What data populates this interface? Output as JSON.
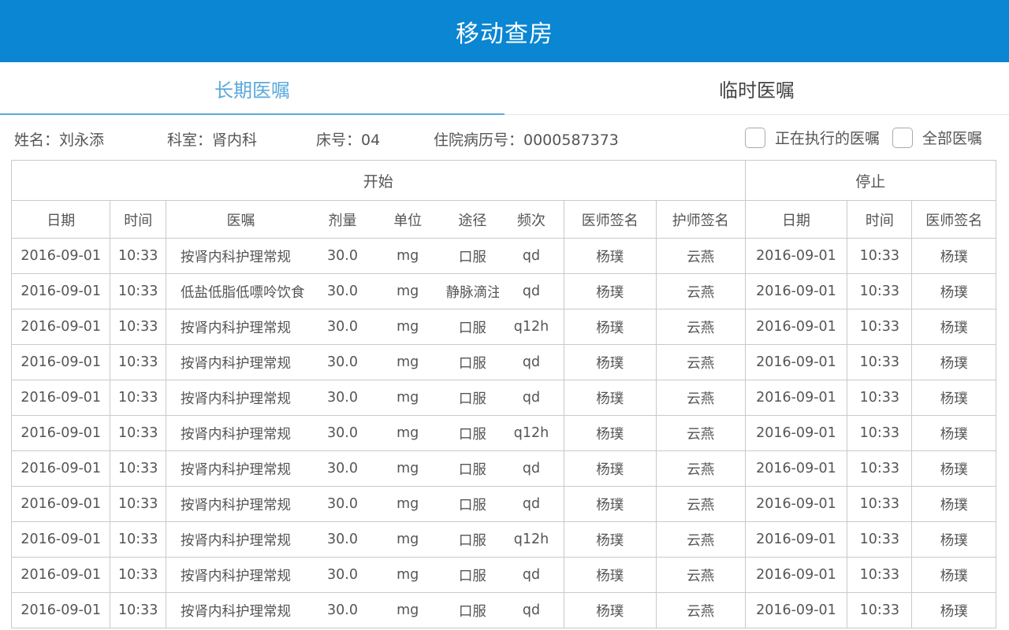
{
  "app": {
    "title": "移动查房"
  },
  "tabs": [
    {
      "label": "长期医嘱",
      "active": true
    },
    {
      "label": "临时医嘱",
      "active": false
    }
  ],
  "patient": {
    "name": "姓名：刘永添",
    "department": "科室：肾内科",
    "bed": "床号：04",
    "record_no": "住院病历号：0000587373"
  },
  "filters": [
    {
      "label": "正在执行的医嘱",
      "checked": false
    },
    {
      "label": "全部医嘱",
      "checked": false
    }
  ],
  "table": {
    "groups": {
      "start": "开始",
      "stop": "停止"
    },
    "headers": [
      "日期",
      "时间",
      "医嘱",
      "剂量",
      "单位",
      "途径",
      "频次",
      "医师签名",
      "护师签名",
      "日期",
      "时间",
      "医师签名"
    ],
    "rows": [
      [
        "2016-09-01",
        "10:33",
        "按肾内科护理常规",
        "30.0",
        "mg",
        "口服",
        "qd",
        "杨璞",
        "云燕",
        "2016-09-01",
        "10:33",
        "杨璞"
      ],
      [
        "2016-09-01",
        "10:33",
        "低盐低脂低嘌呤饮食",
        "30.0",
        "mg",
        "静脉滴注",
        "qd",
        "杨璞",
        "云燕",
        "2016-09-01",
        "10:33",
        "杨璞"
      ],
      [
        "2016-09-01",
        "10:33",
        "按肾内科护理常规",
        "30.0",
        "mg",
        "口服",
        "q12h",
        "杨璞",
        "云燕",
        "2016-09-01",
        "10:33",
        "杨璞"
      ],
      [
        "2016-09-01",
        "10:33",
        "按肾内科护理常规",
        "30.0",
        "mg",
        "口服",
        "qd",
        "杨璞",
        "云燕",
        "2016-09-01",
        "10:33",
        "杨璞"
      ],
      [
        "2016-09-01",
        "10:33",
        "按肾内科护理常规",
        "30.0",
        "mg",
        "口服",
        "qd",
        "杨璞",
        "云燕",
        "2016-09-01",
        "10:33",
        "杨璞"
      ],
      [
        "2016-09-01",
        "10:33",
        "按肾内科护理常规",
        "30.0",
        "mg",
        "口服",
        "q12h",
        "杨璞",
        "云燕",
        "2016-09-01",
        "10:33",
        "杨璞"
      ],
      [
        "2016-09-01",
        "10:33",
        "按肾内科护理常规",
        "30.0",
        "mg",
        "口服",
        "qd",
        "杨璞",
        "云燕",
        "2016-09-01",
        "10:33",
        "杨璞"
      ],
      [
        "2016-09-01",
        "10:33",
        "按肾内科护理常规",
        "30.0",
        "mg",
        "口服",
        "qd",
        "杨璞",
        "云燕",
        "2016-09-01",
        "10:33",
        "杨璞"
      ],
      [
        "2016-09-01",
        "10:33",
        "按肾内科护理常规",
        "30.0",
        "mg",
        "口服",
        "q12h",
        "杨璞",
        "云燕",
        "2016-09-01",
        "10:33",
        "杨璞"
      ],
      [
        "2016-09-01",
        "10:33",
        "按肾内科护理常规",
        "30.0",
        "mg",
        "口服",
        "qd",
        "杨璞",
        "云燕",
        "2016-09-01",
        "10:33",
        "杨璞"
      ],
      [
        "2016-09-01",
        "10:33",
        "按肾内科护理常规",
        "30.0",
        "mg",
        "口服",
        "qd",
        "杨璞",
        "云燕",
        "2016-09-01",
        "10:33",
        "杨璞"
      ]
    ]
  },
  "colors": {
    "header_bg": "#0a86d2",
    "accent": "#5aa9dc"
  }
}
